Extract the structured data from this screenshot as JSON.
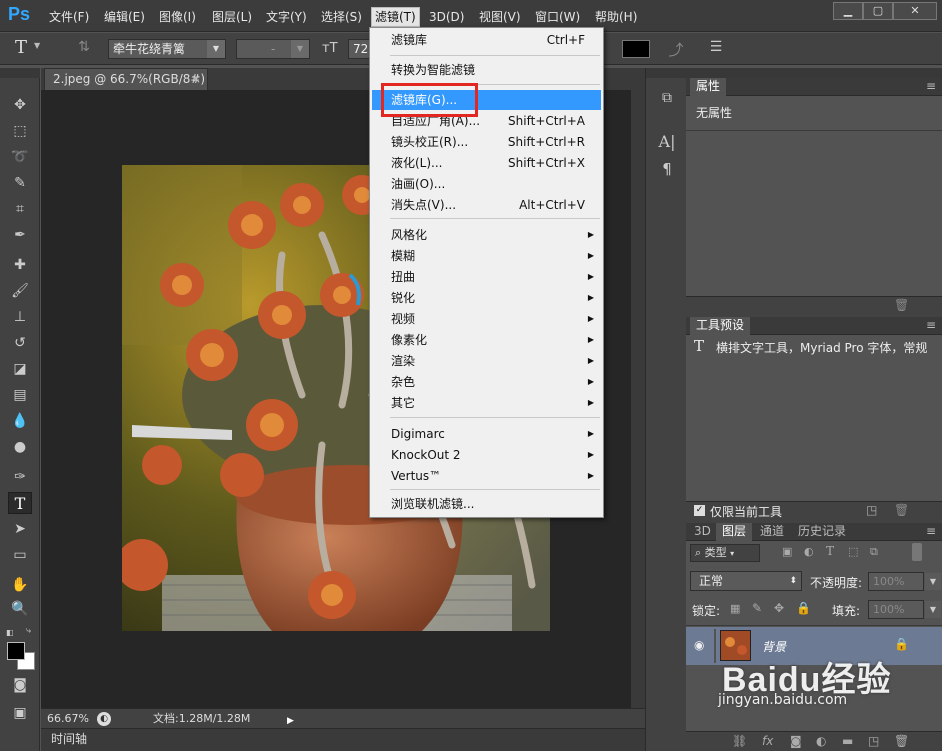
{
  "app": {
    "logo": "Ps"
  },
  "menubar": {
    "items": [
      "文件(F)",
      "编辑(E)",
      "图像(I)",
      "图层(L)",
      "文字(Y)",
      "选择(S)",
      "滤镜(T)",
      "3D(D)",
      "视图(V)",
      "窗口(W)",
      "帮助(H)"
    ],
    "active_index": 6,
    "window_buttons": [
      "▁",
      "▢",
      "✕"
    ]
  },
  "options": {
    "tool_glyph": "T",
    "font_family": "牵牛花绕青篱",
    "font_style": "-",
    "font_size": "72"
  },
  "document": {
    "tab_title": "2.jpeg @ 66.7%(RGB/8#)",
    "tab_close": "×",
    "zoom": "66.67%",
    "doc_info": "文档:1.28M/1.28M"
  },
  "timeline": {
    "label": "时间轴"
  },
  "filter_menu": {
    "groups": [
      [
        {
          "label": "滤镜库",
          "shortcut": "Ctrl+F"
        }
      ],
      [
        {
          "label": "转换为智能滤镜",
          "shortcut": ""
        }
      ],
      [
        {
          "label": "滤镜库(G)...",
          "shortcut": "",
          "highlight": true
        },
        {
          "label": "自适应广角(A)...",
          "shortcut": "Shift+Ctrl+A"
        },
        {
          "label": "镜头校正(R)...",
          "shortcut": "Shift+Ctrl+R"
        },
        {
          "label": "液化(L)...",
          "shortcut": "Shift+Ctrl+X"
        },
        {
          "label": "油画(O)...",
          "shortcut": ""
        },
        {
          "label": "消失点(V)...",
          "shortcut": "Alt+Ctrl+V"
        }
      ],
      [
        {
          "label": "风格化",
          "sub": true
        },
        {
          "label": "模糊",
          "sub": true
        },
        {
          "label": "扭曲",
          "sub": true
        },
        {
          "label": "锐化",
          "sub": true
        },
        {
          "label": "视频",
          "sub": true
        },
        {
          "label": "像素化",
          "sub": true
        },
        {
          "label": "渲染",
          "sub": true
        },
        {
          "label": "杂色",
          "sub": true
        },
        {
          "label": "其它",
          "sub": true
        }
      ],
      [
        {
          "label": "Digimarc",
          "sub": true
        },
        {
          "label": "KnockOut 2",
          "sub": true
        },
        {
          "label": "Vertus™",
          "sub": true
        }
      ],
      [
        {
          "label": "浏览联机滤镜...",
          "shortcut": ""
        }
      ]
    ]
  },
  "properties_panel": {
    "title": "属性",
    "body": "无属性"
  },
  "tool_presets_panel": {
    "title": "工具预设",
    "item": "横排文字工具，Myriad Pro 字体，常规",
    "checkbox_label": "仅限当前工具"
  },
  "layers_panel": {
    "tabs": [
      "3D",
      "图层",
      "通道",
      "历史记录"
    ],
    "active_tab": 1,
    "filter_label": "类型",
    "blend_mode": "正常",
    "opacity_label": "不透明度:",
    "opacity_value": "100%",
    "lock_label": "锁定:",
    "fill_label": "填充:",
    "fill_value": "100%",
    "layer_name": "背景"
  },
  "watermark": {
    "brand": "Baidu经验",
    "url": "jingyan.baidu.com"
  }
}
